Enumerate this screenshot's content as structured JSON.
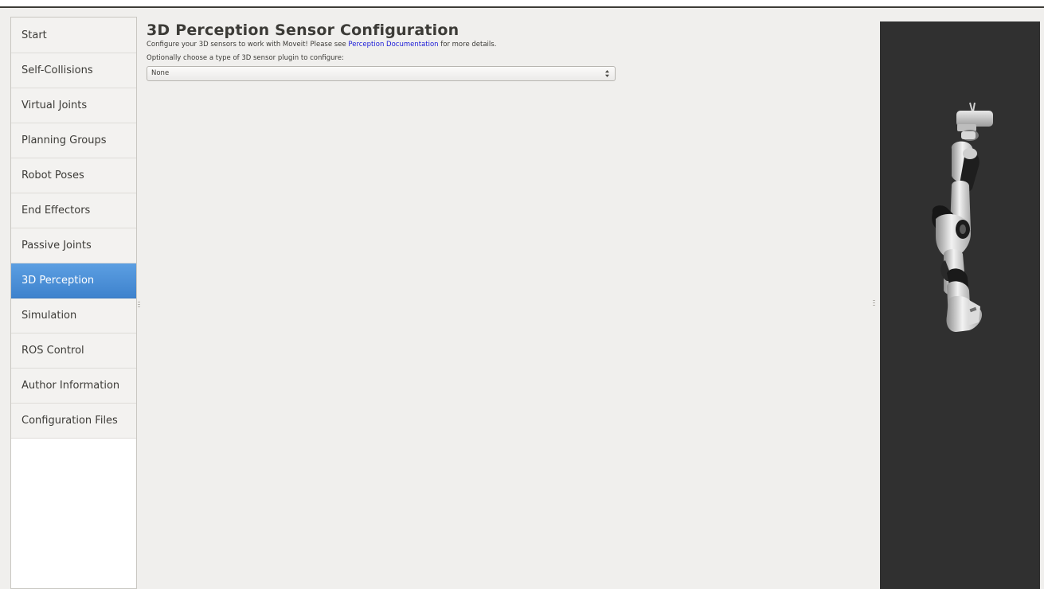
{
  "sidebar": {
    "items": [
      {
        "label": "Start",
        "active": false
      },
      {
        "label": "Self-Collisions",
        "active": false
      },
      {
        "label": "Virtual Joints",
        "active": false
      },
      {
        "label": "Planning Groups",
        "active": false
      },
      {
        "label": "Robot Poses",
        "active": false
      },
      {
        "label": "End Effectors",
        "active": false
      },
      {
        "label": "Passive Joints",
        "active": false
      },
      {
        "label": "3D Perception",
        "active": true
      },
      {
        "label": "Simulation",
        "active": false
      },
      {
        "label": "ROS Control",
        "active": false
      },
      {
        "label": "Author Information",
        "active": false
      },
      {
        "label": "Configuration Files",
        "active": false
      }
    ]
  },
  "main": {
    "title": "3D Perception Sensor Configuration",
    "description_before": "Configure your 3D sensors to work with Moveit! Please see ",
    "description_link": "Perception Documentation",
    "description_after": " for more details.",
    "prompt": "Optionally choose a type of 3D sensor plugin to configure:",
    "plugin_select": {
      "selected": "None"
    }
  },
  "colors": {
    "active_nav": "#4a90d9",
    "link": "#1a1ad8",
    "viewport_bg": "#303030"
  },
  "viewport": {
    "icon": "robot-arm-3d-model"
  }
}
